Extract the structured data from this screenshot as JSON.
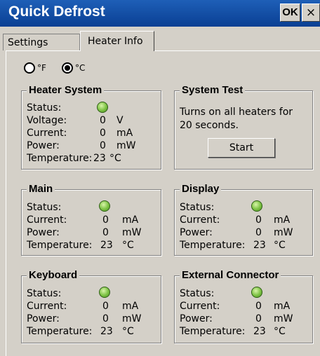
{
  "window": {
    "title": "Quick Defrost",
    "ok_label": "OK",
    "close_label": "×"
  },
  "tabs": [
    {
      "label": "Settings"
    },
    {
      "label": "Heater Info"
    }
  ],
  "units": {
    "f_label": "°F",
    "c_label": "°C",
    "selected": "°C"
  },
  "colors": {
    "title_bar": "#0a3f93",
    "status_led": "#7bc142",
    "window_bg": "#d4d0c8"
  },
  "heater_system": {
    "title": "Heater System",
    "status_label": "Status:",
    "voltage_label": "Voltage:",
    "voltage_value": "0",
    "voltage_unit": "V",
    "current_label": "Current:",
    "current_value": "0",
    "current_unit": "mA",
    "power_label": "Power:",
    "power_value": "0",
    "power_unit": "mW",
    "temp_label": "Temperature:",
    "temp_value": "23",
    "temp_unit": "°C"
  },
  "system_test": {
    "title": "System Test",
    "desc_line1": "Turns on all heaters for",
    "desc_line2": "20 seconds.",
    "start_label": "Start"
  },
  "main": {
    "title": "Main",
    "status_label": "Status:",
    "current_label": "Current:",
    "current_value": "0",
    "current_unit": "mA",
    "power_label": "Power:",
    "power_value": "0",
    "power_unit": "mW",
    "temp_label": "Temperature:",
    "temp_value": "23",
    "temp_unit": "°C"
  },
  "display": {
    "title": "Display",
    "status_label": "Status:",
    "current_label": "Current:",
    "current_value": "0",
    "current_unit": "mA",
    "power_label": "Power:",
    "power_value": "0",
    "power_unit": "mW",
    "temp_label": "Temperature:",
    "temp_value": "23",
    "temp_unit": "°C"
  },
  "keyboard": {
    "title": "Keyboard",
    "status_label": "Status:",
    "current_label": "Current:",
    "current_value": "0",
    "current_unit": "mA",
    "power_label": "Power:",
    "power_value": "0",
    "power_unit": "mW",
    "temp_label": "Temperature:",
    "temp_value": "23",
    "temp_unit": "°C"
  },
  "external": {
    "title": "External Connector",
    "status_label": "Status:",
    "current_label": "Current:",
    "current_value": "0",
    "current_unit": "mA",
    "power_label": "Power:",
    "power_value": "0",
    "power_unit": "mW",
    "temp_label": "Temperature:",
    "temp_value": "23",
    "temp_unit": "°C"
  }
}
